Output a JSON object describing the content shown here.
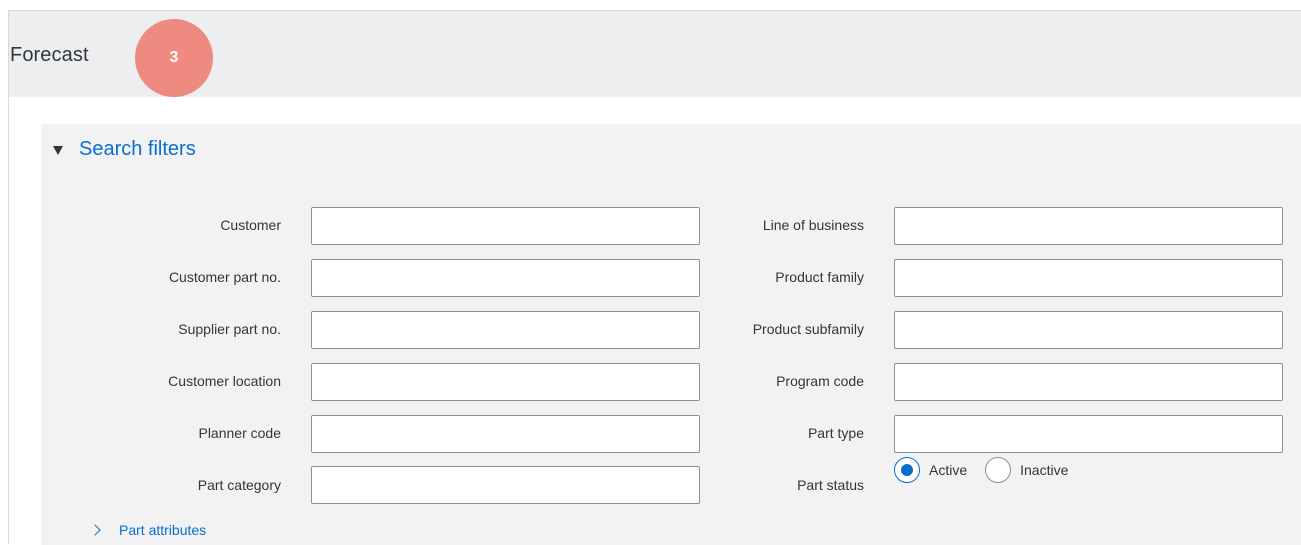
{
  "header": {
    "title": "Forecast",
    "step_badge": "3"
  },
  "filters": {
    "section_title": "Search filters",
    "left": [
      {
        "label": "Customer",
        "value": ""
      },
      {
        "label": "Customer part no.",
        "value": ""
      },
      {
        "label": "Supplier part no.",
        "value": ""
      },
      {
        "label": "Customer location",
        "value": ""
      },
      {
        "label": "Planner code",
        "value": ""
      },
      {
        "label": "Part category",
        "value": ""
      }
    ],
    "right": [
      {
        "label": "Line of business",
        "value": ""
      },
      {
        "label": "Product family",
        "value": ""
      },
      {
        "label": "Product subfamily",
        "value": ""
      },
      {
        "label": "Program code",
        "value": ""
      },
      {
        "label": "Part type",
        "value": ""
      }
    ],
    "part_status": {
      "label": "Part status",
      "options": [
        "Active",
        "Inactive"
      ],
      "selected": "Active"
    },
    "part_attributes_label": "Part attributes"
  },
  "colors": {
    "accent": "#0a6ed1",
    "badge": "#ef8a80",
    "header_bg": "#edeef0",
    "panel_bg": "#f2f2f2"
  }
}
